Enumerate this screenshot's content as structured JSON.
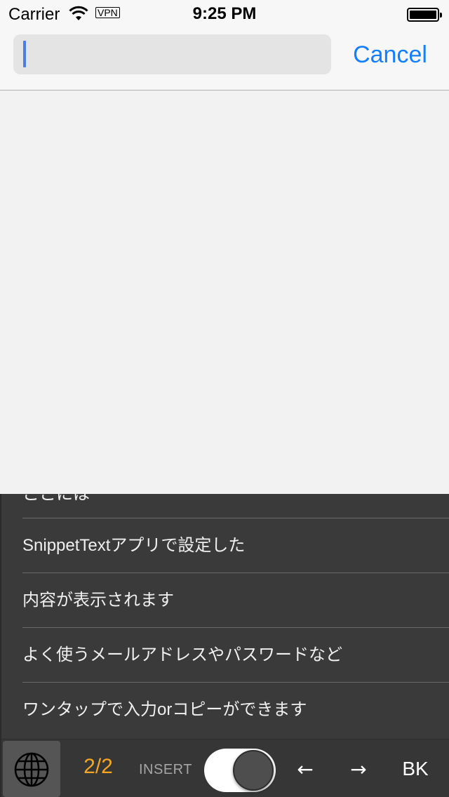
{
  "status_bar": {
    "carrier": "Carrier",
    "vpn": "VPN",
    "time": "9:25 PM",
    "battery_level": 1.0
  },
  "search": {
    "value": "",
    "placeholder": "",
    "cancel_label": "Cancel"
  },
  "keyboard": {
    "snippets": [
      "ここには",
      "SnippetTextアプリで設定した",
      "内容が表示されます",
      "よく使うメールアドレスやパスワードなど",
      "ワンタップで入力orコピーができます"
    ],
    "page_indicator": "2/2",
    "insert_label": "INSERT",
    "insert_toggle_on": true,
    "left_key": "←",
    "right_key": "→",
    "backspace_label": "BK",
    "globe_icon": "globe-icon"
  },
  "colors": {
    "accent": "#157efb",
    "page_indicator": "#f5a623",
    "keyboard_bg": "#3a3a3a",
    "content_bg": "#f2f2f2"
  }
}
